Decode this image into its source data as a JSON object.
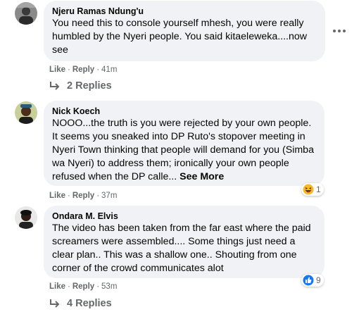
{
  "comments": [
    {
      "author": "Njeru Ramas Ndung'u",
      "text": "You need this to console yourself mhesh, you were really humbled by the Nyeri people. You said kitaeleweka....now see",
      "like": "Like",
      "reply": "Reply",
      "time": "41m",
      "replies": "2 Replies"
    },
    {
      "author": "Nick Koech",
      "text": "NOOO...the truth is you were rejected by your own people. It seems you sneaked into DP Ruto's stopover meeting in Nyeri Town thinking that people will demand for you (Simba wa Nyeri) to address them; ironically your own people refused when the DP calle...",
      "see_more": "See More",
      "like": "Like",
      "reply": "Reply",
      "time": "37m",
      "reaction_count": "1",
      "reaction_icon": "haha-emoji-icon"
    },
    {
      "author": "Ondara M. Elvis",
      "text": "The video has been taken from the far east where the paid screamers were assembled.... Some things just need a clear plan.. This was a shallow one.. Shouting from one corner of the crowd communicates alot",
      "like": "Like",
      "reply": "Reply",
      "time": "53m",
      "reaction_count": "9",
      "reaction_icon": "thumbs-up-icon",
      "replies": "4 Replies"
    }
  ],
  "colors": {
    "bubble": "#f0f2f5",
    "meta_text": "#65676b",
    "like_blue": "#1877f2",
    "haha_yellow": "#f7b928"
  }
}
